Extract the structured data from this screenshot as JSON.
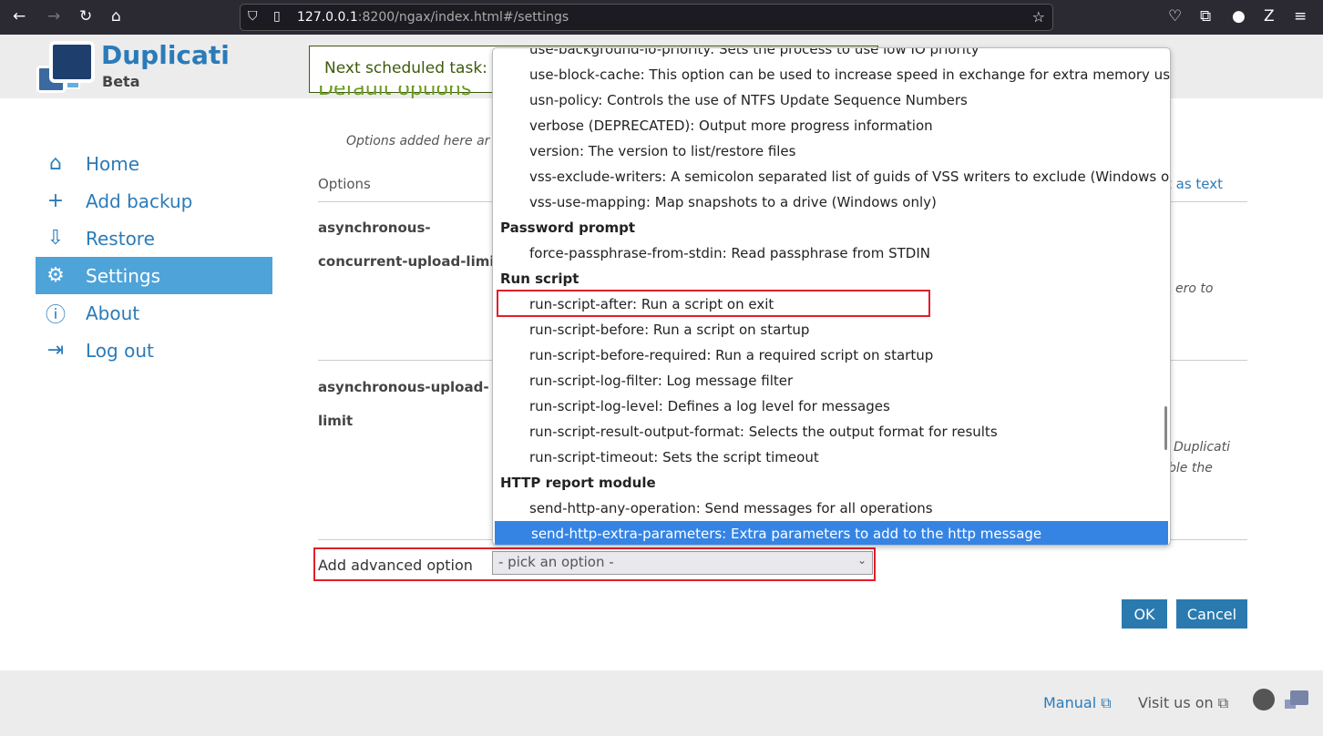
{
  "browser": {
    "url_host": "127.0.0.1",
    "url_rest": ":8200/ngax/index.html#/settings"
  },
  "brand": {
    "name": "Duplicati",
    "tag": "Beta"
  },
  "schedule": {
    "label": "Next scheduled task:"
  },
  "sidebar": {
    "items": [
      {
        "label": "Home",
        "icon": "home-icon",
        "glyph": "⌂"
      },
      {
        "label": "Add backup",
        "icon": "plus-icon",
        "glyph": "+"
      },
      {
        "label": "Restore",
        "icon": "restore-icon",
        "glyph": "⇩"
      },
      {
        "label": "Settings",
        "icon": "gear-icon",
        "glyph": "⚙"
      },
      {
        "label": "About",
        "icon": "info-icon",
        "glyph": "ⓘ"
      },
      {
        "label": "Log out",
        "icon": "logout-icon",
        "glyph": "⇥"
      }
    ],
    "active": 3
  },
  "main": {
    "title": "Default options",
    "description": "Options added here ar",
    "column_header": "Options",
    "edit_as_text": "t as text",
    "options": [
      {
        "name_line1": "asynchronous-",
        "name_line2": "concurrent-upload-limit",
        "desc_fragment": "ero to"
      },
      {
        "name_line1": "asynchronous-upload-",
        "name_line2": "limit",
        "desc_fragment1": "Duplicati",
        "desc_fragment2": "ble the"
      }
    ],
    "add_option_label": "Add advanced option",
    "select_value": "- pick an option -",
    "ok": "OK",
    "cancel": "Cancel"
  },
  "dropdown": {
    "selected": "send-http-extra-parameters",
    "highlighted_box": "run-script-after",
    "items": [
      {
        "type": "item",
        "text": "use-background-io-priority: Sets the process to use low IO priority"
      },
      {
        "type": "item",
        "text": "use-block-cache: This option can be used to increase speed in exchange for extra memory use."
      },
      {
        "type": "item",
        "text": "usn-policy: Controls the use of NTFS Update Sequence Numbers"
      },
      {
        "type": "item",
        "text": "verbose (DEPRECATED): Output more progress information"
      },
      {
        "type": "item",
        "text": "version: The version to list/restore files"
      },
      {
        "type": "item",
        "text": "vss-exclude-writers: A semicolon separated list of guids of VSS writers to exclude (Windows only)"
      },
      {
        "type": "item",
        "text": "vss-use-mapping: Map snapshots to a drive (Windows only)"
      },
      {
        "type": "group",
        "text": "Password prompt"
      },
      {
        "type": "item",
        "text": "force-passphrase-from-stdin: Read passphrase from STDIN"
      },
      {
        "type": "group",
        "text": "Run script"
      },
      {
        "type": "item",
        "text": "run-script-after: Run a script on exit"
      },
      {
        "type": "item",
        "text": "run-script-before: Run a script on startup"
      },
      {
        "type": "item",
        "text": "run-script-before-required: Run a required script on startup"
      },
      {
        "type": "item",
        "text": "run-script-log-filter: Log message filter"
      },
      {
        "type": "item",
        "text": "run-script-log-level: Defines a log level for messages"
      },
      {
        "type": "item",
        "text": "run-script-result-output-format: Selects the output format for results"
      },
      {
        "type": "item",
        "text": "run-script-timeout: Sets the script timeout"
      },
      {
        "type": "group",
        "text": "HTTP report module"
      },
      {
        "type": "item",
        "text": "send-http-any-operation: Send messages for all operations"
      },
      {
        "type": "item",
        "text": "send-http-extra-parameters: Extra parameters to add to the http message",
        "selected": true
      }
    ]
  },
  "footer": {
    "manual": "Manual",
    "visit": "Visit us on"
  }
}
